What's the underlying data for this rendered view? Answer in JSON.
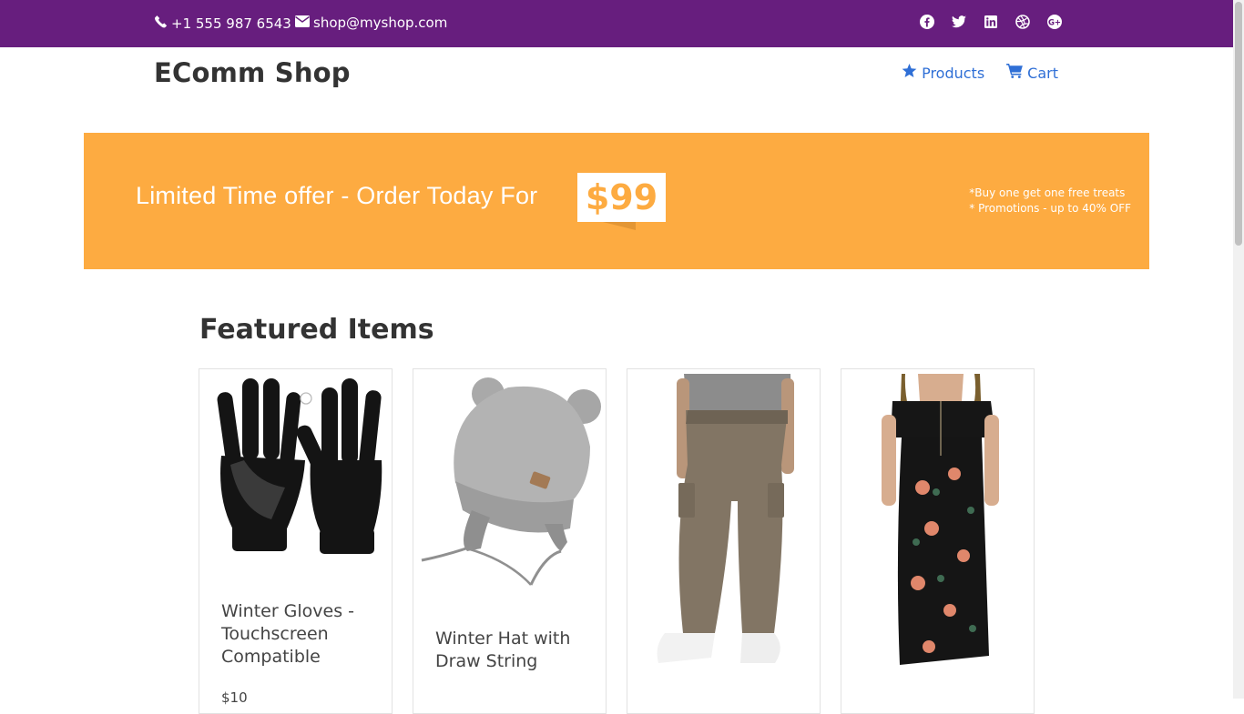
{
  "topbar": {
    "phone": "+1 555 987 6543",
    "email": "shop@myshop.com",
    "social_icons": [
      "facebook-icon",
      "twitter-icon",
      "linkedin-icon",
      "dribbble-icon",
      "google-plus-icon"
    ]
  },
  "nav": {
    "brand": "EComm Shop",
    "items": [
      {
        "label": "Products",
        "icon": "star-icon"
      },
      {
        "label": "Cart",
        "icon": "cart-icon"
      }
    ]
  },
  "banner": {
    "text": "Limited Time offer - Order Today For",
    "price": "$99",
    "promo_lines": [
      "*Buy one get one free treats",
      "* Promotions - up to 40% OFF"
    ]
  },
  "featured": {
    "title": "Featured Items",
    "items": [
      {
        "name": "Winter Gloves - Touchscreen Compatible",
        "price": "$10"
      },
      {
        "name": "Winter Hat with Draw String",
        "price": ""
      },
      {
        "name": "",
        "price": ""
      },
      {
        "name": "",
        "price": ""
      }
    ]
  },
  "colors": {
    "topbar": "#671e7e",
    "banner": "#fdab41",
    "link": "#2f6fd6"
  }
}
